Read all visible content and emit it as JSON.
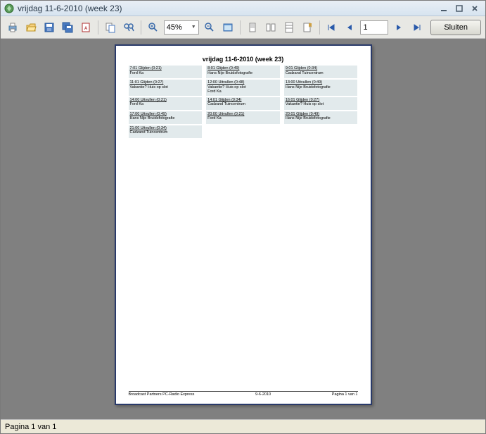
{
  "window": {
    "title": "vrijdag 11-6-2010 (week 23)"
  },
  "toolbar": {
    "zoom": "45%",
    "page": "1",
    "close_label": "Sluiten"
  },
  "page": {
    "heading": "vrijdag 11-6-2010 (week 23)",
    "schedule": [
      [
        {
          "time": "7:01 Glijden (0:21)",
          "desc": "Ford Ka"
        },
        {
          "time": "8:01 Glijden (0:49)",
          "desc": "Hans Nije Bruidsfotografie"
        },
        {
          "time": "9:01 Glijden (0:34)",
          "desc": "Cadzand Tuincentrum"
        }
      ],
      [
        {
          "time": "11:01 Glijden (0:27)",
          "desc": "Vakantie? Huis op slot"
        },
        {
          "time": "12:00 Uitvullen (0:48)",
          "desc": "Vakantie? Huis op slot\nFord Ka"
        },
        {
          "time": "13:00 Uitvullen (0:49)",
          "desc": "Hans Nije Bruidsfotografie"
        }
      ],
      [
        {
          "time": "14:00 Uitvullen (0:21)",
          "desc": "Ford Ka"
        },
        {
          "time": "14:01 Glijden (0:34)",
          "desc": "Cadzand Tuincentrum"
        },
        {
          "time": "16:01 Glijden (0:27)",
          "desc": "Vakantie? Huis op slot"
        }
      ],
      [
        {
          "time": "17:00 Uitvullen (0:49)",
          "desc": "Hans Nije Bruidsfotografie"
        },
        {
          "time": "20:00 Uitvullen (0:21)",
          "desc": "Ford Ka"
        },
        {
          "time": "20:01 Glijden (0:49)",
          "desc": "Hans Nije Bruidsfotografie"
        }
      ],
      [
        {
          "time": "21:00 Uitvullen (0:34)",
          "desc": "Cadzand Tuincentrum"
        },
        null,
        null
      ]
    ],
    "footer": {
      "left": "Broadcast Partners PC-Radio Express",
      "center": "9-6-2010",
      "right": "Pagina 1 van 1"
    }
  },
  "status": {
    "text": "Pagina 1 van 1"
  }
}
